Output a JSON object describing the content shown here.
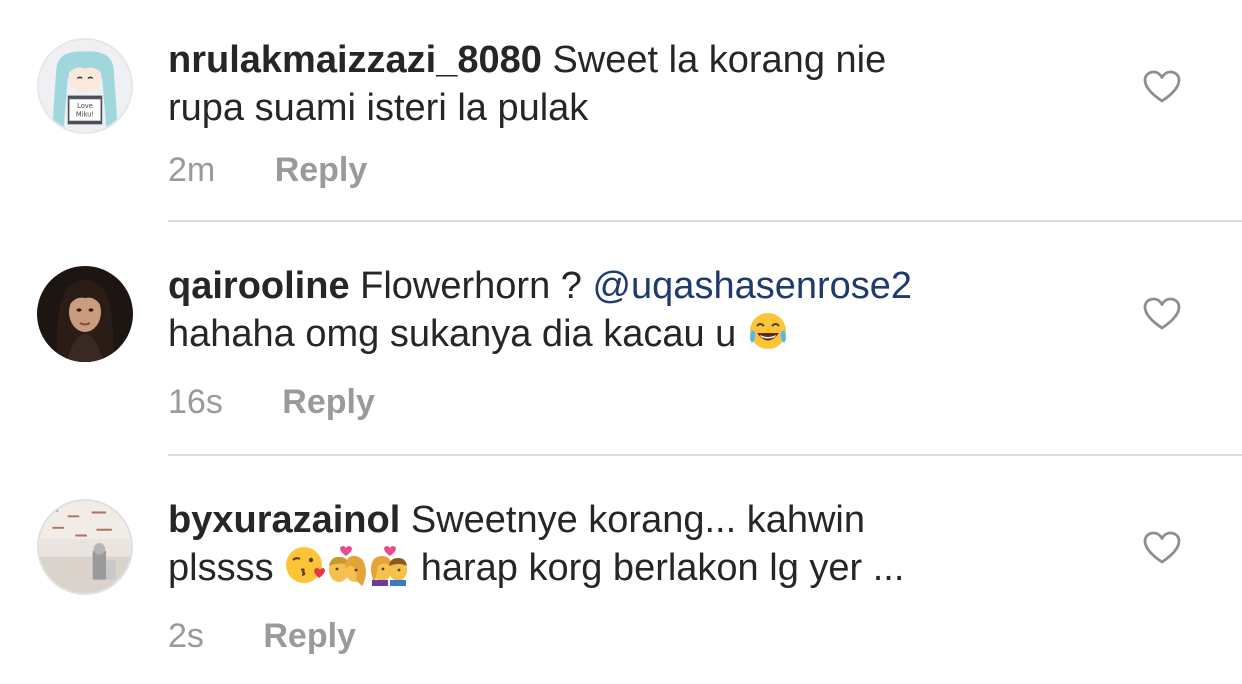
{
  "comments": [
    {
      "username": "nrulakmaizzazi_8080",
      "text_line1": "Sweet la korang nie",
      "text_line2": "rupa suami isteri la pulak",
      "time": "2m",
      "reply_label": "Reply",
      "avatar_icon": "anime-girl-avatar",
      "like_icon": "heart-outline-icon"
    },
    {
      "username": "qairooline",
      "text_part1": "Flowerhorn ? ",
      "mention": "@uqashasenrose2",
      "text_line2": "hahaha omg sukanya dia kacau u",
      "emoji": "face-with-tears-of-joy",
      "time": "16s",
      "reply_label": "Reply",
      "avatar_icon": "woman-portrait-avatar",
      "like_icon": "heart-outline-icon"
    },
    {
      "username": "byxurazainol",
      "text_line1": "Sweetnye korang... kahwin",
      "text_line2a": "plssss",
      "text_line2b": "harap korg berlakon lg yer ...",
      "emojis": [
        "face-blowing-a-kiss",
        "kiss-couple",
        "kiss-couple"
      ],
      "time": "2s",
      "reply_label": "Reply",
      "avatar_icon": "room-photo-avatar",
      "like_icon": "heart-outline-icon"
    }
  ],
  "colors": {
    "text": "#262626",
    "meta": "#9a9a9a",
    "mention": "#1e3a6e",
    "divider": "#dbdbdb"
  }
}
